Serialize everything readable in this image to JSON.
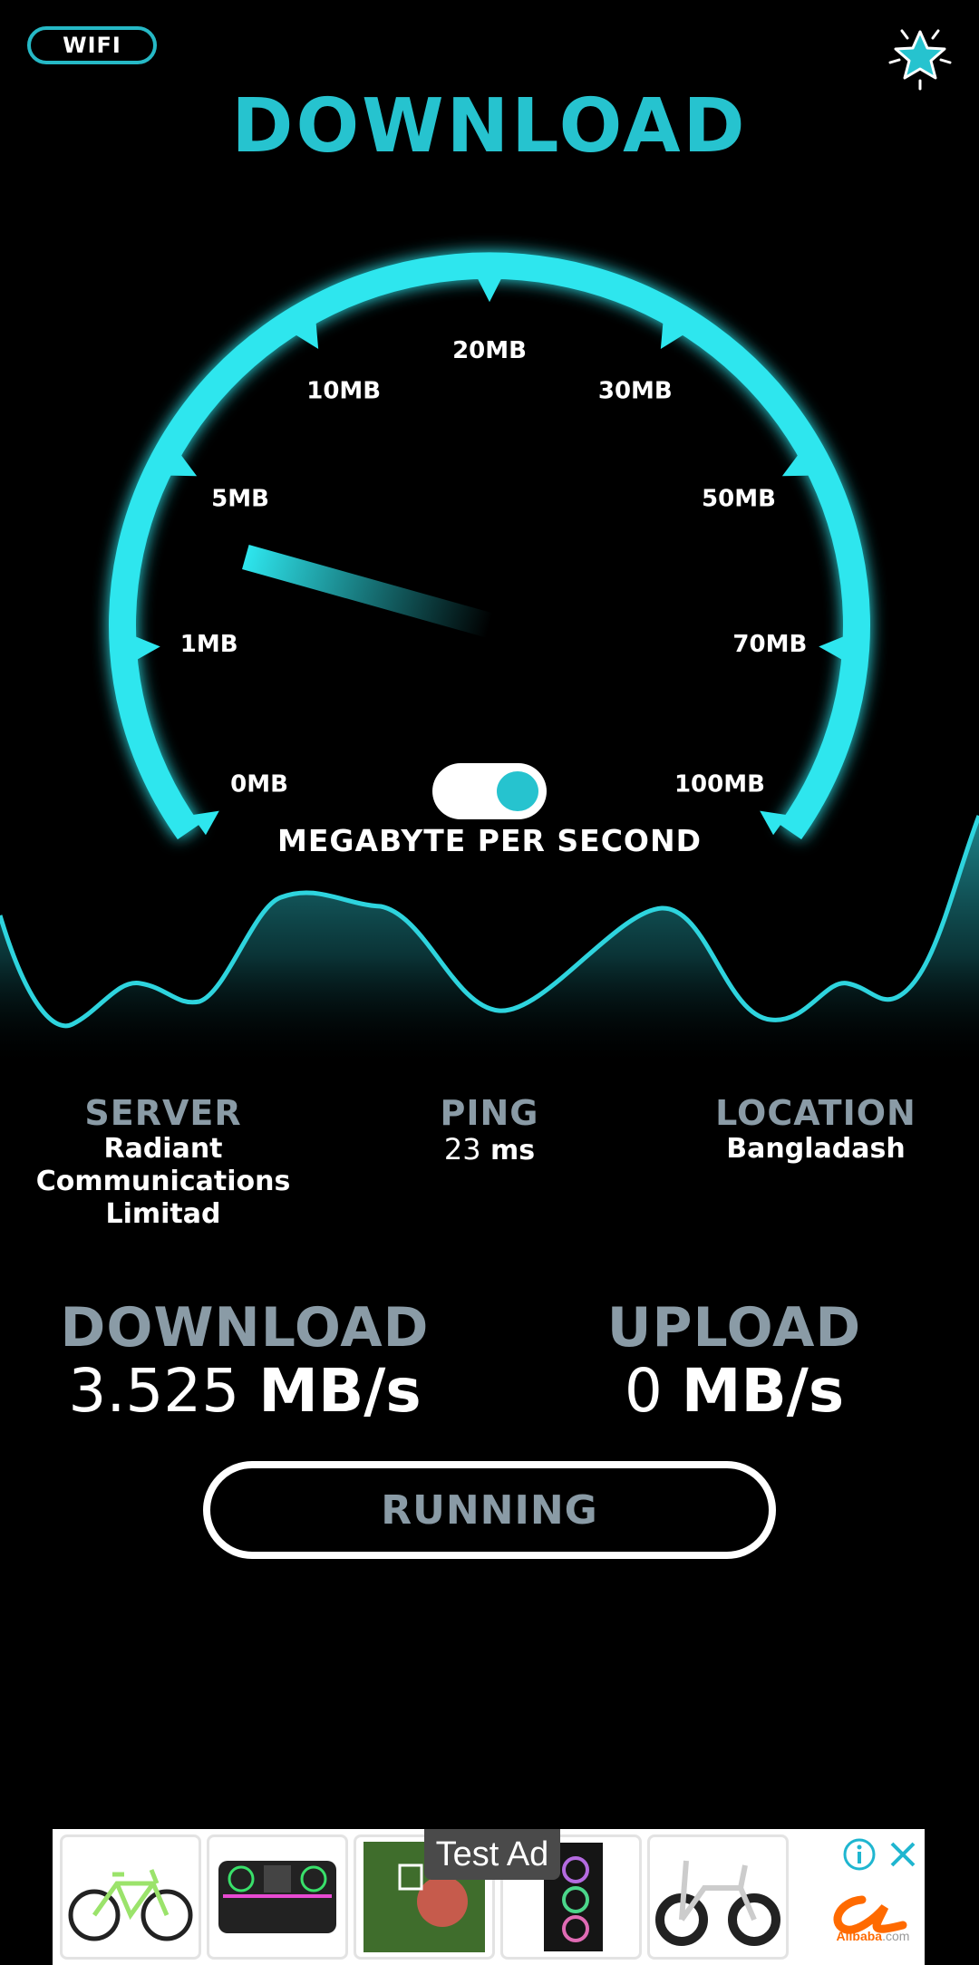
{
  "header": {
    "connection_label": "WIFI",
    "title": "DOWNLOAD",
    "rate_icon": "sparkle-star-icon"
  },
  "gauge": {
    "ticks": [
      {
        "label": "0MB",
        "value": 0
      },
      {
        "label": "1MB",
        "value": 1
      },
      {
        "label": "5MB",
        "value": 5
      },
      {
        "label": "10MB",
        "value": 10
      },
      {
        "label": "20MB",
        "value": 20
      },
      {
        "label": "30MB",
        "value": 30
      },
      {
        "label": "50MB",
        "value": 50
      },
      {
        "label": "70MB",
        "value": 70
      },
      {
        "label": "100MB",
        "value": 100
      }
    ],
    "needle_value_mb": 3.525,
    "accent_color": "#2ee6ee",
    "unit_toggle_on": true,
    "unit_label": "MEGABYTE PER SECOND"
  },
  "stats": {
    "server": {
      "label": "SERVER",
      "value_lines": [
        "Radiant",
        "Communications",
        "Limitad"
      ]
    },
    "ping": {
      "label": "PING",
      "value": "23",
      "unit": "ms"
    },
    "location": {
      "label": "LOCATION",
      "value": "Bangladash"
    }
  },
  "results": {
    "download": {
      "label": "DOWNLOAD",
      "value": "3.525",
      "unit": "MB/s"
    },
    "upload": {
      "label": "UPLOAD",
      "value": "0",
      "unit": "MB/s"
    }
  },
  "status_button": {
    "label": "RUNNING"
  },
  "ad": {
    "badge": "Test Ad",
    "brand": "Alibaba",
    "brand_suffix": ".com",
    "products": [
      "mountain-bike",
      "audio-mixer",
      "green-wall-plants",
      "pc-case-rgb",
      "folding-e-bike"
    ],
    "info_icon": "info-icon",
    "close_icon": "close-icon"
  }
}
